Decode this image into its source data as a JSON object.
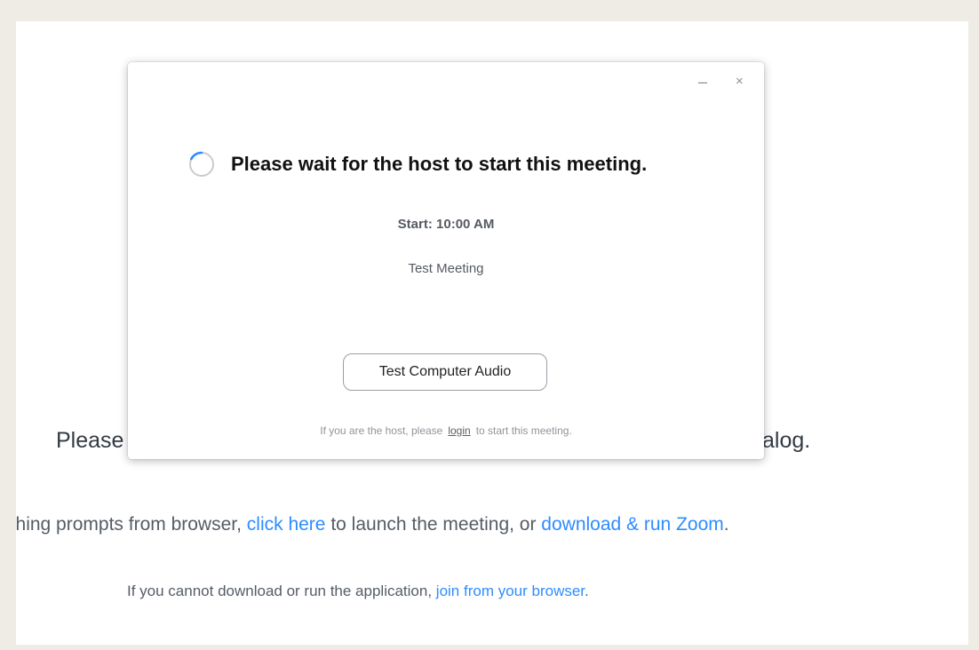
{
  "background": {
    "line1_left": "Please",
    "line1_right": "alog.",
    "line2": {
      "prefix": "othing prompts from browser, ",
      "link1": "click here",
      "middle": " to launch the meeting, or ",
      "link2": "download & run Zoom",
      "suffix": "."
    },
    "line3": {
      "prefix": "If you cannot download or run the application, ",
      "link": "join from your browser",
      "suffix": "."
    }
  },
  "dialog": {
    "minimize_label": "–",
    "close_label": "×",
    "title": "Please wait for the host to start this meeting.",
    "start_time": "Start: 10:00 AM",
    "meeting_name": "Test Meeting",
    "audio_button_label": "Test Computer Audio",
    "host_note": {
      "prefix": "If you are the host, please",
      "login_link": "login",
      "suffix": "to start this meeting."
    }
  },
  "colors": {
    "link": "#2d8cff",
    "spinner": "#2d8cff"
  },
  "icons": {
    "spinner": "loading-spinner-icon"
  }
}
